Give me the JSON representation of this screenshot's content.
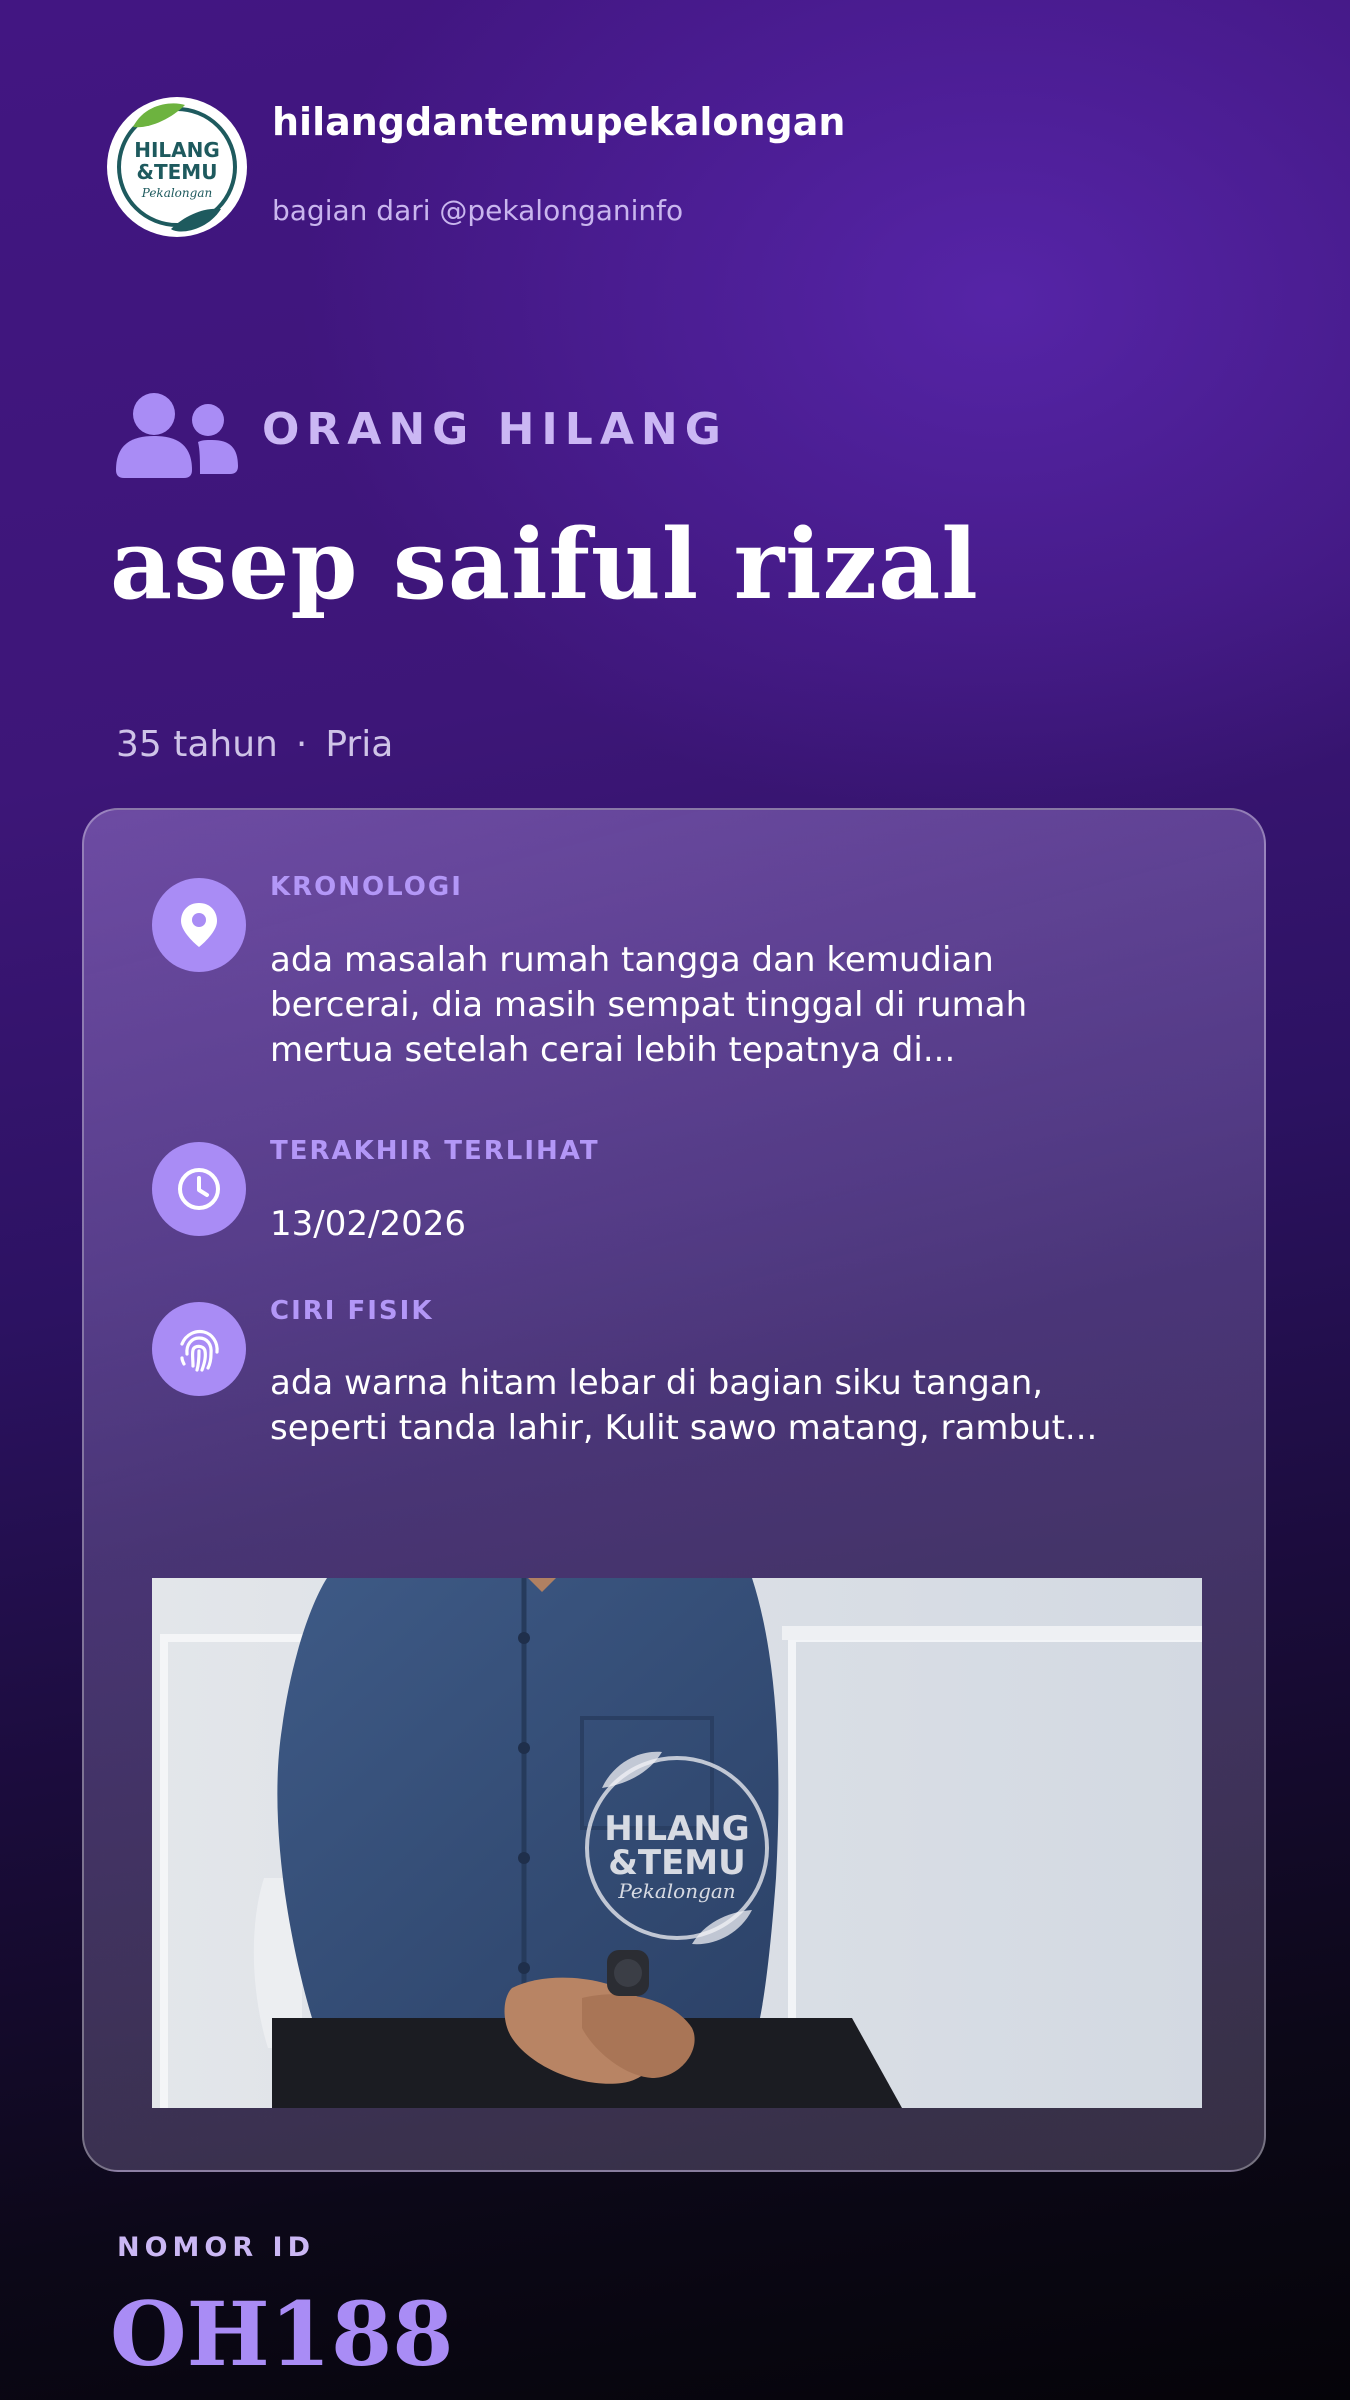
{
  "header": {
    "account_name": "hilangdantemupekalongan",
    "account_subtitle": "bagian dari @pekalonganinfo",
    "logo": {
      "line1": "HILANG",
      "line2": "&TEMU",
      "script": "Pekalongan",
      "color": "#1e5a5e",
      "leaf_color": "#6db33f"
    }
  },
  "category": {
    "icon": "users-icon",
    "label": "ORANG HILANG"
  },
  "person": {
    "name": "asep saiful rizal",
    "age": "35 tahun",
    "separator": "·",
    "gender": "Pria"
  },
  "details": [
    {
      "icon": "location-pin-icon",
      "label": "KRONOLOGI",
      "text": "ada masalah rumah tangga dan kemudian bercerai, dia masih sempat tinggal di rumah mertua setelah cerai lebih tepatnya di..."
    },
    {
      "icon": "clock-icon",
      "label": "TERAKHIR TERLIHAT",
      "text": "13/02/2026"
    },
    {
      "icon": "fingerprint-icon",
      "label": "CIRI FISIK",
      "text": "ada warna hitam lebar di bagian siku tangan, seperti tanda lahir, Kulit sawo matang, rambut..."
    }
  ],
  "photo": {
    "watermark_line1": "HILANG",
    "watermark_line2": "&TEMU",
    "watermark_script": "Pekalongan"
  },
  "id": {
    "label": "NOMOR ID",
    "value": "OH188"
  },
  "colors": {
    "accent": "#a98cf5",
    "label": "#b397f7"
  }
}
